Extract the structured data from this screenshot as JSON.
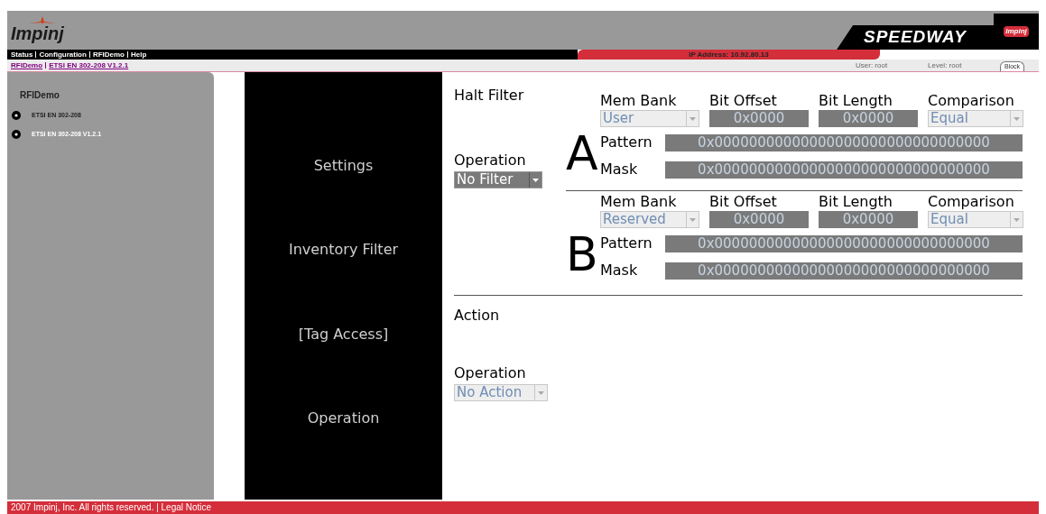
{
  "header": {
    "logo": "Impinj",
    "product": "SPEEDWAY",
    "badge": "Impinj"
  },
  "nav": {
    "links": [
      "Status",
      "Configuration",
      "RFIDemo",
      "Help"
    ],
    "ip": "IP Address: 10.92.80.13"
  },
  "breadcrumb": {
    "links": [
      "RFIDemo",
      "ETSI EN 302-208 V1.2.1"
    ],
    "user": "User: root",
    "level": "Level: root",
    "tab": "Block"
  },
  "sidebar": {
    "title": "RFIDemo",
    "items": [
      {
        "label": "ETSI EN 302-208"
      },
      {
        "label": "ETSI EN 302-208 V1.2.1"
      }
    ]
  },
  "menu": [
    {
      "label": "Settings"
    },
    {
      "label": "Inventory Filter"
    },
    {
      "label": "[Tag Access]"
    },
    {
      "label": "Operation"
    }
  ],
  "halt_filter": {
    "title": "Halt Filter",
    "operation_label": "Operation",
    "operation": {
      "value": "No Filter",
      "disabled": false
    },
    "filters": [
      {
        "letter": "A",
        "columns": [
          "Mem Bank",
          "Bit Offset",
          "Bit Length",
          "Comparison"
        ],
        "mem_bank": {
          "value": "User",
          "disabled": true
        },
        "bit_offset": "0x0000",
        "bit_length": "0x0000",
        "comparison": {
          "value": "Equal",
          "disabled": true
        },
        "pattern_label": "Pattern",
        "pattern": "0x00000000000000000000000000000000",
        "mask_label": "Mask",
        "mask": "0x00000000000000000000000000000000"
      },
      {
        "letter": "B",
        "columns": [
          "Mem Bank",
          "Bit Offset",
          "Bit Length",
          "Comparison"
        ],
        "mem_bank": {
          "value": "Reserved",
          "disabled": true
        },
        "bit_offset": "0x0000",
        "bit_length": "0x0000",
        "comparison": {
          "value": "Equal",
          "disabled": true
        },
        "pattern_label": "Pattern",
        "pattern": "0x00000000000000000000000000000000",
        "mask_label": "Mask",
        "mask": "0x00000000000000000000000000000000"
      }
    ]
  },
  "action": {
    "title": "Action",
    "operation_label": "Operation",
    "operation": {
      "value": "No Action",
      "disabled": true
    }
  },
  "footer": {
    "text": "2007 Impinj, Inc. All rights reserved. | Legal Notice"
  }
}
